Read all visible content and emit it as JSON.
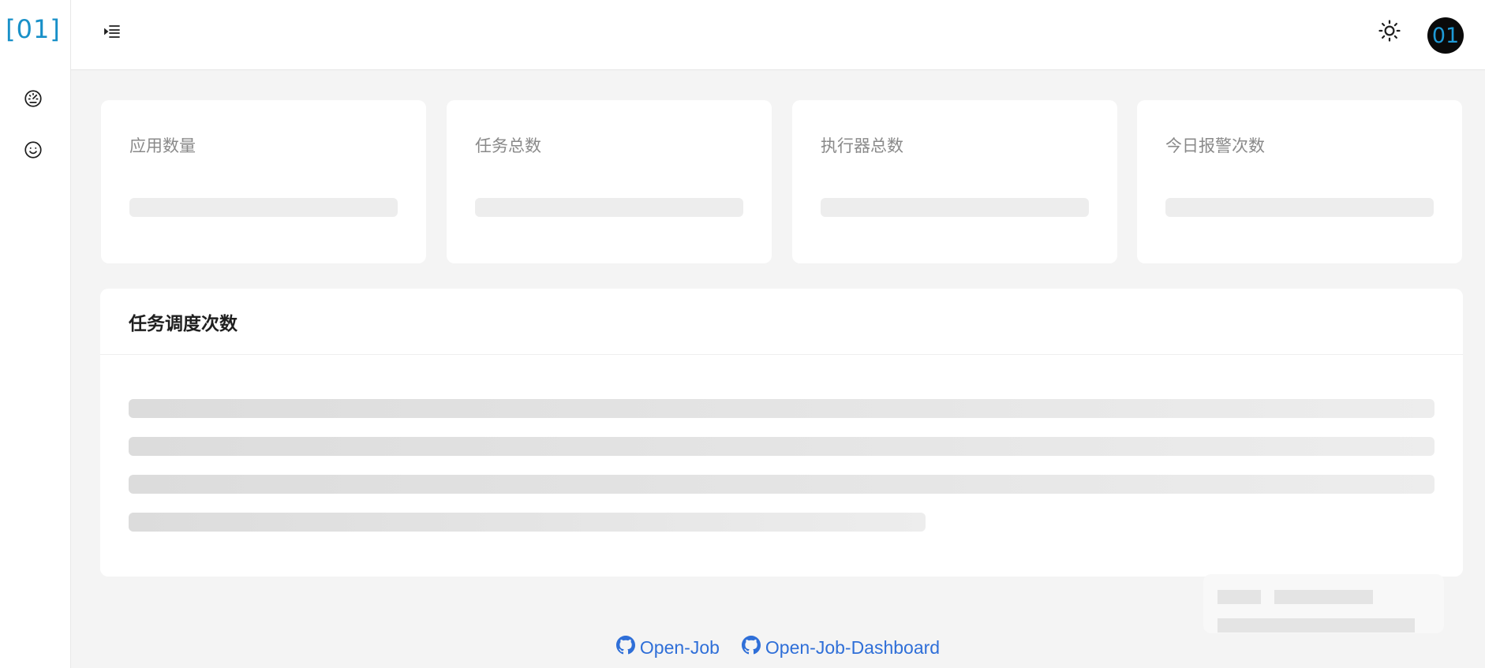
{
  "app": {
    "logo_text": "[01]",
    "avatar_text": "01"
  },
  "sidebar": {
    "items": [
      {
        "icon": "dashboard-gauge-icon"
      },
      {
        "icon": "smiley-face-icon"
      }
    ]
  },
  "header": {
    "menu_icon": "menu-indent-icon",
    "theme_icon": "sun-icon"
  },
  "stats": [
    {
      "label": "应用数量"
    },
    {
      "label": "任务总数"
    },
    {
      "label": "执行器总数"
    },
    {
      "label": "今日报警次数"
    }
  ],
  "chart_card": {
    "title": "任务调度次数"
  },
  "footer": {
    "links": [
      {
        "label": "Open-Job",
        "icon": "github-icon"
      },
      {
        "label": "Open-Job-Dashboard",
        "icon": "github-icon"
      }
    ]
  },
  "colors": {
    "brand": "#1890c8",
    "link": "#2f6fd8",
    "background": "#f4f4f4",
    "skeleton": "#ededed"
  }
}
